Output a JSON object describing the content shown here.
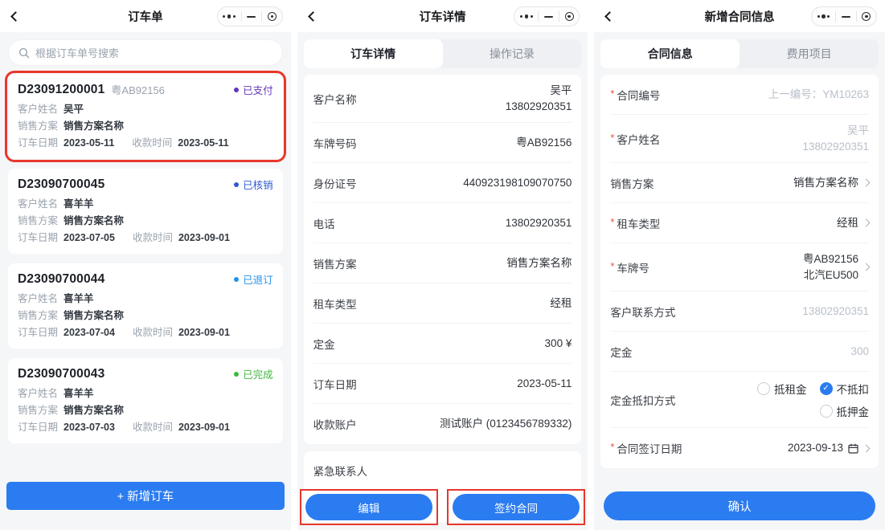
{
  "colors": {
    "accent_blue": "#2b7cf0",
    "annotation_red": "#e8372c",
    "status_paid_purple": "#6236b8",
    "status_verified_blue": "#2d5bd1",
    "status_cancelled_blue": "#2590ea",
    "status_done_green": "#3eb73e",
    "page_background": "#f5f6f8",
    "muted_text": "#b9c0ca"
  },
  "ui": {
    "required_mark": "*",
    "check_mark": "✓"
  },
  "orders": {
    "title": "订车单",
    "search_placeholder": "根据订车单号搜索",
    "labels": {
      "customer": "客户姓名",
      "plan": "销售方案",
      "order_date": "订车日期",
      "pay_time": "收款时间"
    },
    "cards": [
      {
        "order_no": "D23091200001",
        "plate": "粤AB92156",
        "status": "已支付",
        "status_color": "#6236b8",
        "customer": "吴平",
        "plan": "销售方案名称",
        "order_date": "2023-05-11",
        "pay_time": "2023-05-11"
      },
      {
        "order_no": "D23090700045",
        "status": "已核销",
        "status_color": "#2d5bd1",
        "customer": "喜羊羊",
        "plan": "销售方案名称",
        "order_date": "2023-07-05",
        "pay_time": "2023-09-01"
      },
      {
        "order_no": "D23090700044",
        "status": "已退订",
        "status_color": "#2590ea",
        "customer": "喜羊羊",
        "plan": "销售方案名称",
        "order_date": "2023-07-04",
        "pay_time": "2023-09-01"
      },
      {
        "order_no": "D23090700043",
        "status": "已完成",
        "status_color": "#3eb73e",
        "customer": "喜羊羊",
        "plan": "销售方案名称",
        "order_date": "2023-07-03",
        "pay_time": "2023-09-01"
      }
    ],
    "add_button": "+ 新增订车"
  },
  "detail": {
    "title": "订车详情",
    "tabs": [
      {
        "label": "订车详情"
      },
      {
        "label": "操作记录"
      }
    ],
    "rows": [
      {
        "label": "客户名称",
        "value_lines": [
          "吴平",
          "13802920351"
        ]
      },
      {
        "label": "车牌号码",
        "value_lines": [
          "粤AB92156"
        ]
      },
      {
        "label": "身份证号",
        "value_lines": [
          "440923198109070750"
        ]
      },
      {
        "label": "电话",
        "value_lines": [
          "13802920351"
        ]
      },
      {
        "label": "销售方案",
        "value_lines": [
          "销售方案名称"
        ]
      },
      {
        "label": "租车类型",
        "value_lines": [
          "经租"
        ]
      },
      {
        "label": "定金",
        "value_lines": [
          "300 ¥"
        ]
      },
      {
        "label": "订车日期",
        "value_lines": [
          "2023-05-11"
        ]
      },
      {
        "label": "收款账户",
        "value_lines": [
          "测试账户 (0123456789332)"
        ]
      }
    ],
    "emergency_section": "紧急联系人",
    "buttons": [
      {
        "label": "编辑"
      },
      {
        "label": "签约合同"
      }
    ]
  },
  "contract": {
    "title": "新增合同信息",
    "tabs": [
      {
        "label": "合同信息"
      },
      {
        "label": "费用项目"
      }
    ],
    "rows": [
      {
        "label": "合同编号",
        "required": true,
        "value_lines": [
          "上一编号：YM10263"
        ],
        "muted": true
      },
      {
        "label": "客户姓名",
        "required": true,
        "value_lines": [
          "吴平",
          "13802920351"
        ],
        "muted": true
      },
      {
        "label": "销售方案",
        "value_lines": [
          "销售方案名称"
        ]
      },
      {
        "label": "租车类型",
        "required": true,
        "value_lines": [
          "经租"
        ]
      },
      {
        "label": "车牌号",
        "required": true,
        "value_lines": [
          "粤AB92156",
          "北汽EU500"
        ]
      },
      {
        "label": "客户联系方式",
        "value_lines": [
          "13802920351"
        ],
        "muted": true
      },
      {
        "label": "定金",
        "value_lines": [
          "300"
        ],
        "muted": true
      },
      {
        "label": "定金抵扣方式",
        "options": [
          {
            "label": "抵租金",
            "checked": false
          },
          {
            "label": "不抵扣",
            "checked": true
          },
          {
            "label": "抵押金",
            "checked": false
          }
        ]
      },
      {
        "label": "合同签订日期",
        "required": true,
        "value_lines": [
          "2023-09-13"
        ]
      }
    ],
    "confirm_button": "确认"
  }
}
